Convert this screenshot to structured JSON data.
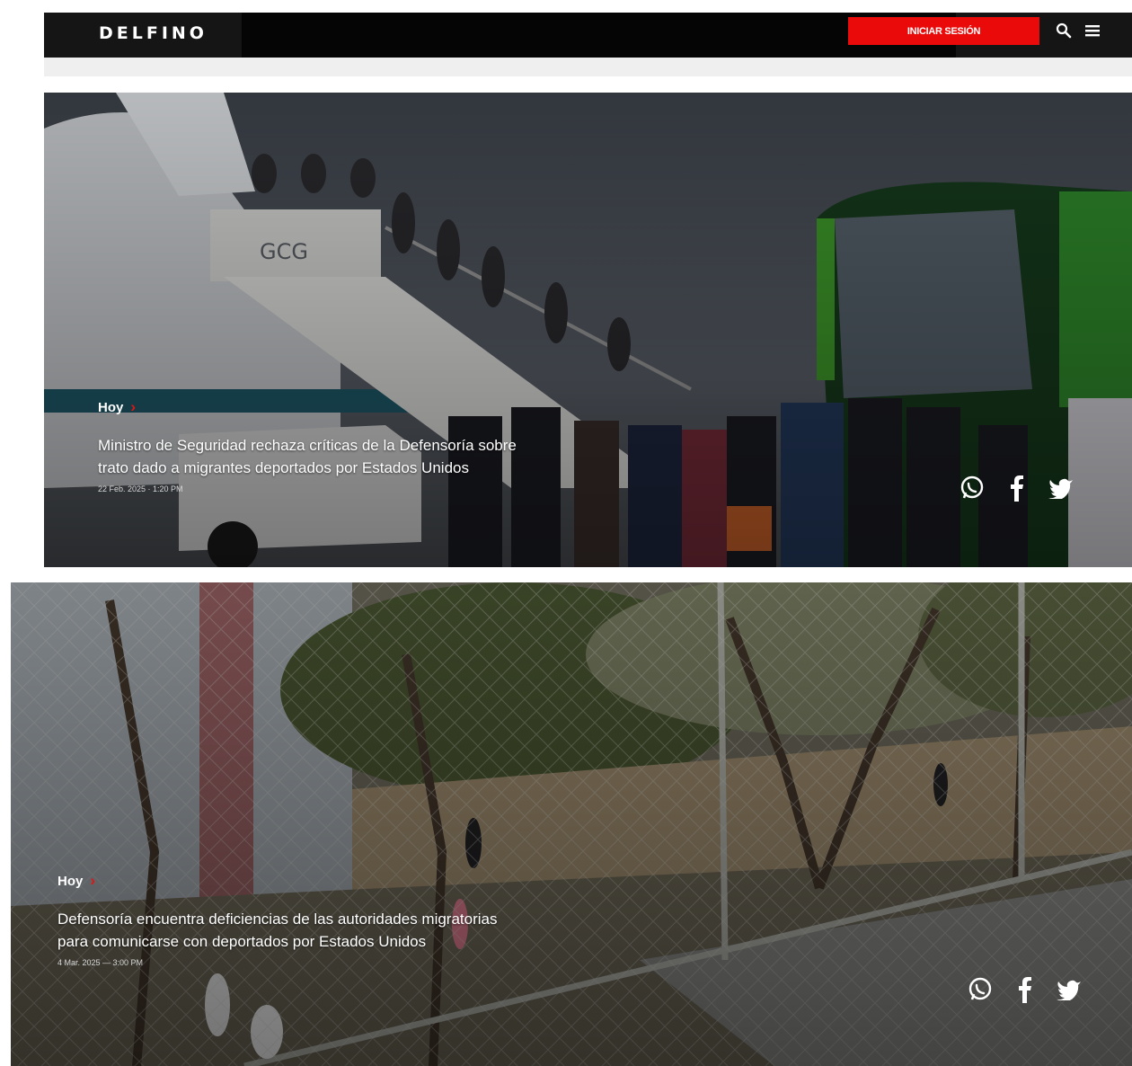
{
  "header": {
    "logo": "DELFINO",
    "login_label": "INICIAR SESIÓN"
  },
  "icons": {
    "search": "search-icon",
    "menu": "hamburger-menu-icon",
    "whatsapp": "whatsapp-icon",
    "facebook": "facebook-icon",
    "twitter": "twitter-icon",
    "chevron": "chevron-right-icon"
  },
  "colors": {
    "accent": "#ea0a0a",
    "header_bg": "#151515"
  },
  "articles": [
    {
      "section": "Hoy",
      "headline": "Ministro de Seguridad rechaza críticas de la Defensoría sobre trato dado a migrantes deportados por Estados Unidos",
      "date": "22 Feb. 2025 · 1:20 PM"
    },
    {
      "section": "Hoy",
      "headline": "Defensoría encuentra deficiencias de las autoridades migratorias para comunicarse con deportados por Estados Unidos",
      "date": "4 Mar. 2025 — 3:00 PM"
    }
  ]
}
